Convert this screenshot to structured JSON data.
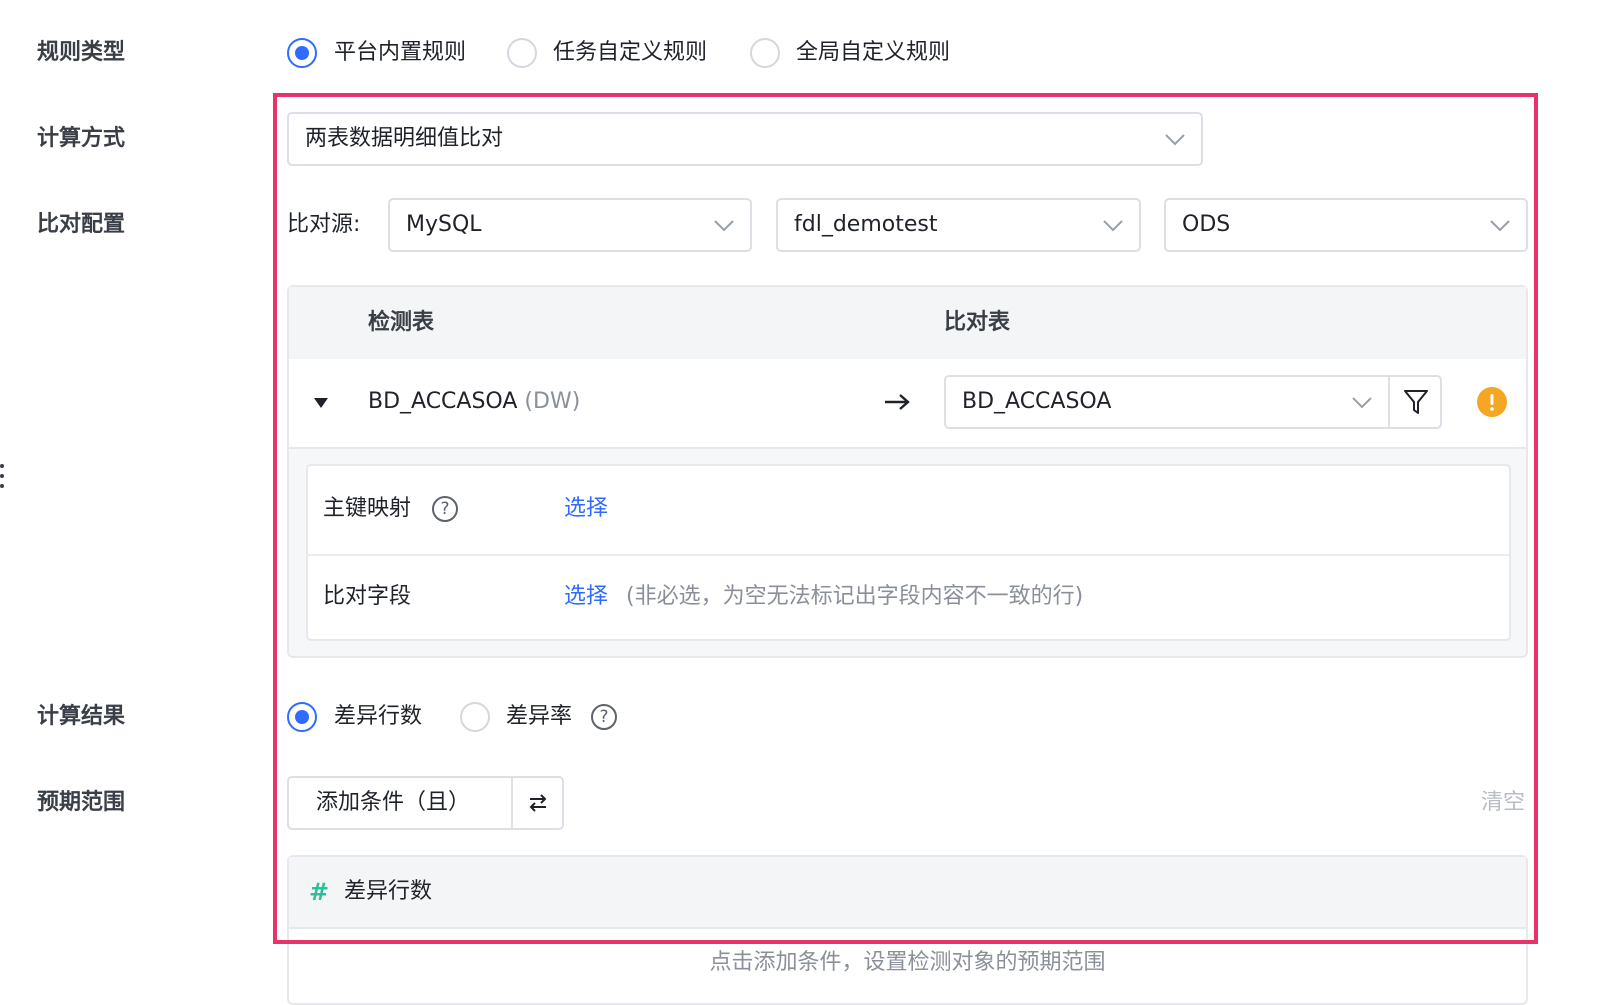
{
  "form": {
    "rule_type": {
      "label": "规则类型",
      "options": [
        {
          "label": "平台内置规则",
          "checked": true
        },
        {
          "label": "任务自定义规则",
          "checked": false
        },
        {
          "label": "全局自定义规则",
          "checked": false
        }
      ]
    },
    "calc_method": {
      "label": "计算方式",
      "value": "两表数据明细值比对"
    },
    "compare_config": {
      "label": "比对配置",
      "source_label": "比对源:",
      "source_type": "MySQL",
      "database": "fdl_demotest",
      "schema": "ODS",
      "table": {
        "header_check": "检测表",
        "header_compare": "比对表",
        "check_table": "BD_ACCASOA",
        "check_table_suffix": "(DW)",
        "compare_table": "BD_ACCASOA"
      },
      "pk_mapping": {
        "label": "主键映射",
        "help": "?",
        "action": "选择"
      },
      "compare_fields": {
        "label": "比对字段",
        "action": "选择",
        "hint": "(非必选，为空无法标记出字段内容不一致的行)"
      }
    },
    "calc_result": {
      "label": "计算结果",
      "options": [
        {
          "label": "差异行数",
          "checked": true
        },
        {
          "label": "差异率",
          "checked": false
        }
      ],
      "help": "?"
    },
    "expected_range": {
      "label": "预期范围",
      "add_condition": "添加条件（且）",
      "clear": "清空",
      "metric_icon": "#",
      "metric": "差异行数",
      "empty_hint": "点击添加条件，设置检测对象的预期范围"
    }
  },
  "colors": {
    "accent": "#2f6bff",
    "highlight": "#e8336a",
    "warning": "#f5a623",
    "metric_icon": "#2bbf9b"
  },
  "icons": {
    "chevron": "chevron-down-icon",
    "arrow": "arrow-right-icon",
    "filter": "filter-icon",
    "warning": "warning-circle-icon",
    "swap": "swap-icon",
    "caret": "caret-down-icon"
  }
}
